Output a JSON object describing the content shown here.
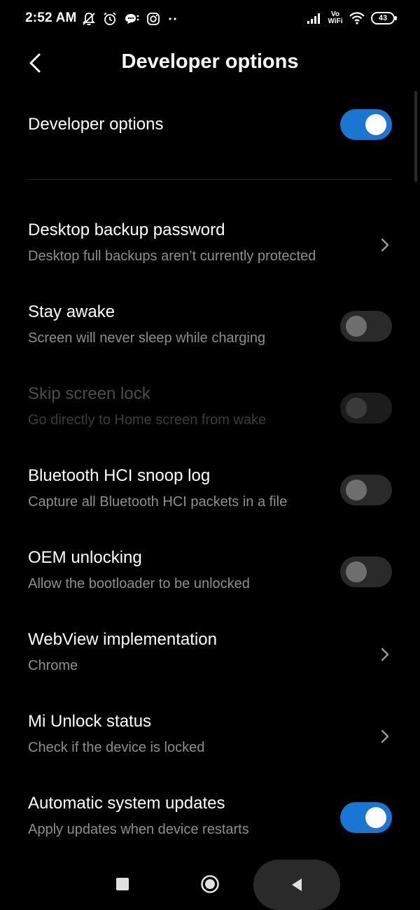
{
  "status_bar": {
    "time": "2:52 AM",
    "left_icons": [
      "notifications-off-icon",
      "alarm-icon",
      "chat-bubble-icon",
      "instagram-icon",
      "more-dots-icon"
    ],
    "volte_top": "Vo",
    "volte_bottom": "WiFi",
    "battery": "43"
  },
  "header": {
    "title": "Developer options",
    "back_icon": "chevron-left-icon"
  },
  "master_toggle": {
    "label": "Developer options",
    "state": "on"
  },
  "settings": [
    {
      "title": "Desktop backup password",
      "subtitle": "Desktop full backups aren’t currently protected",
      "control": "chevron"
    },
    {
      "title": "Stay awake",
      "subtitle": "Screen will never sleep while charging",
      "control": "toggle",
      "state": "off"
    },
    {
      "title": "Skip screen lock",
      "subtitle": "Go directly to Home screen from wake",
      "control": "toggle",
      "state": "disabled"
    },
    {
      "title": "Bluetooth HCI snoop log",
      "subtitle": "Capture all Bluetooth HCI packets in a file",
      "control": "toggle",
      "state": "off"
    },
    {
      "title": "OEM unlocking",
      "subtitle": "Allow the bootloader to be unlocked",
      "control": "toggle",
      "state": "off"
    },
    {
      "title": "WebView implementation",
      "subtitle": "Chrome",
      "control": "chevron"
    },
    {
      "title": "Mi Unlock status",
      "subtitle": "Check if the device is locked",
      "control": "chevron"
    },
    {
      "title": "Automatic system updates",
      "subtitle": "Apply updates when device restarts",
      "control": "toggle",
      "state": "on"
    }
  ],
  "colors": {
    "background": "#000000",
    "accent": "#1976d2",
    "text_primary": "#ffffff",
    "text_secondary": "#8e8e8e"
  },
  "nav_bar": {
    "icons": [
      "recents-square-icon",
      "home-circle-icon",
      "back-triangle-icon"
    ]
  }
}
